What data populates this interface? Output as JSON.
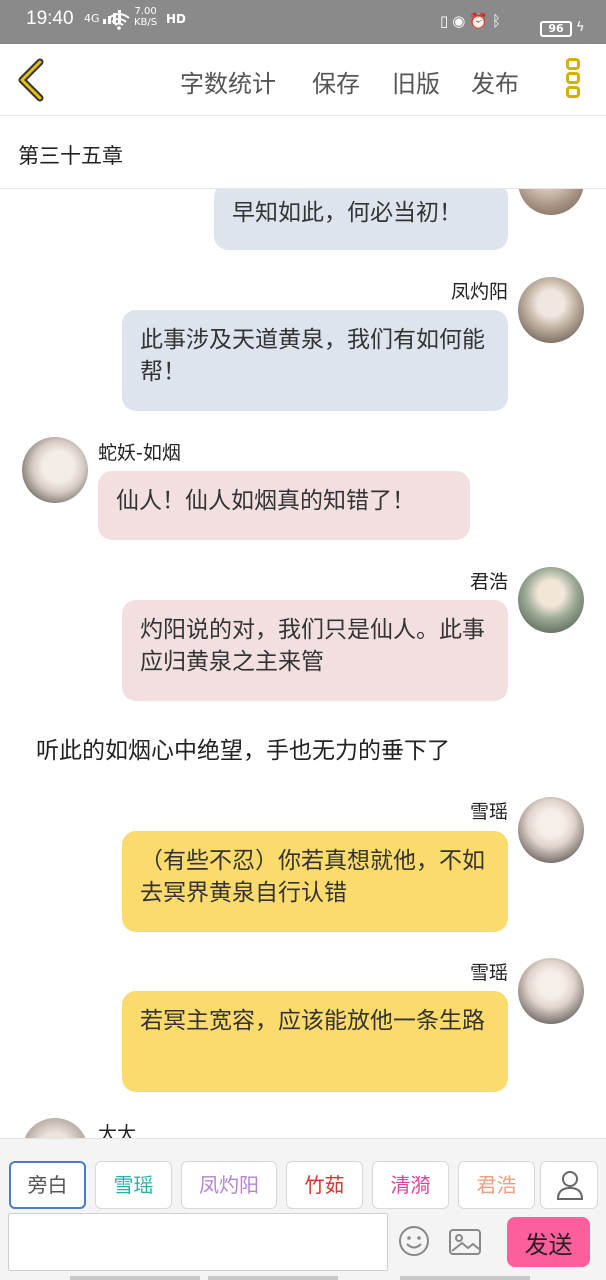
{
  "status_bar": {
    "time": "19:40",
    "network": "4G",
    "speed_value": "7.00",
    "speed_unit": "KB/S",
    "hd": "HD",
    "battery": "96",
    "icons": [
      "vibrate-icon",
      "data-saver-icon",
      "alarm-icon",
      "bluetooth-icon"
    ]
  },
  "toolbar": {
    "back_icon": "chevron-left-icon",
    "actions": [
      "字数统计",
      "保存",
      "旧版",
      "发布"
    ],
    "more_icon": "more-vertical-icon",
    "accent_color": "#d4b000"
  },
  "chapter": {
    "title": "第三十五章"
  },
  "messages": [
    {
      "side": "right",
      "speaker": "",
      "text": "早知如此，何必当初！",
      "color": "#dde4ee"
    },
    {
      "side": "right",
      "speaker": "凤灼阳",
      "text": "此事涉及天道黄泉，我们有如何能帮！",
      "color": "#dde4ee"
    },
    {
      "side": "left",
      "speaker": "蛇妖-如烟",
      "text": "仙人！仙人如烟真的知错了！",
      "color": "#f2dfe0"
    },
    {
      "side": "right",
      "speaker": "君浩",
      "text": "灼阳说的对，我们只是仙人。此事应归黄泉之主来管",
      "color": "#f2dfe0"
    },
    {
      "side": "right",
      "speaker": "雪瑶",
      "text": "（有些不忍）你若真想就他，不如去冥界黄泉自行认错",
      "color": "#fcdb6d"
    },
    {
      "side": "right",
      "speaker": "雪瑶",
      "text": "若冥主宽容，应该能放他一条生路",
      "color": "#fcdb6d"
    },
    {
      "side": "left",
      "speaker": "大大",
      "text": "",
      "color": "#ffffff"
    }
  ],
  "narration": "听此的如烟心中绝望，手也无力的垂下了",
  "roles": [
    {
      "label": "旁白",
      "color": "#555555",
      "active": true
    },
    {
      "label": "雪瑶",
      "color": "#2ab0a8",
      "active": false
    },
    {
      "label": "凤灼阳",
      "color": "#b583cf",
      "active": false
    },
    {
      "label": "竹茹",
      "color": "#d9342b",
      "active": false
    },
    {
      "label": "清漪",
      "color": "#e0449a",
      "active": false
    },
    {
      "label": "君浩",
      "color": "#f0a080",
      "active": false
    }
  ],
  "composer": {
    "person_icon": "person-icon",
    "input_placeholder": "",
    "emoji_icon": "emoji-icon",
    "image_icon": "image-icon",
    "send_label": "发送",
    "send_color": "#fc5f9c"
  }
}
